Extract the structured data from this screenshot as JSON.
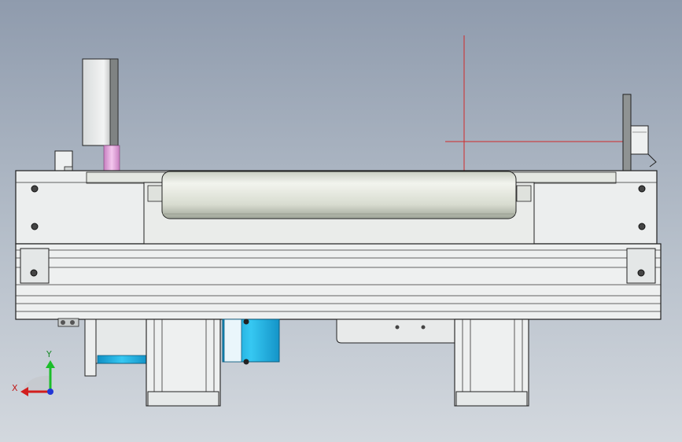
{
  "app": {
    "view": "cad-3d-viewport"
  },
  "colors": {
    "background_top": "#8f9bad",
    "background_bottom": "#d3d8de",
    "metal": "#ecefee",
    "roller": "#e6e9df",
    "motor_blue": "#1eb6e8",
    "pink_shaft": "#e6a8e0",
    "axis_x": "#d21e1e",
    "axis_y": "#1cbd2a",
    "axis_z": "#2236d6",
    "origin_line": "#d02a2a"
  },
  "triad": {
    "x_label": "X",
    "y_label": "Y"
  }
}
